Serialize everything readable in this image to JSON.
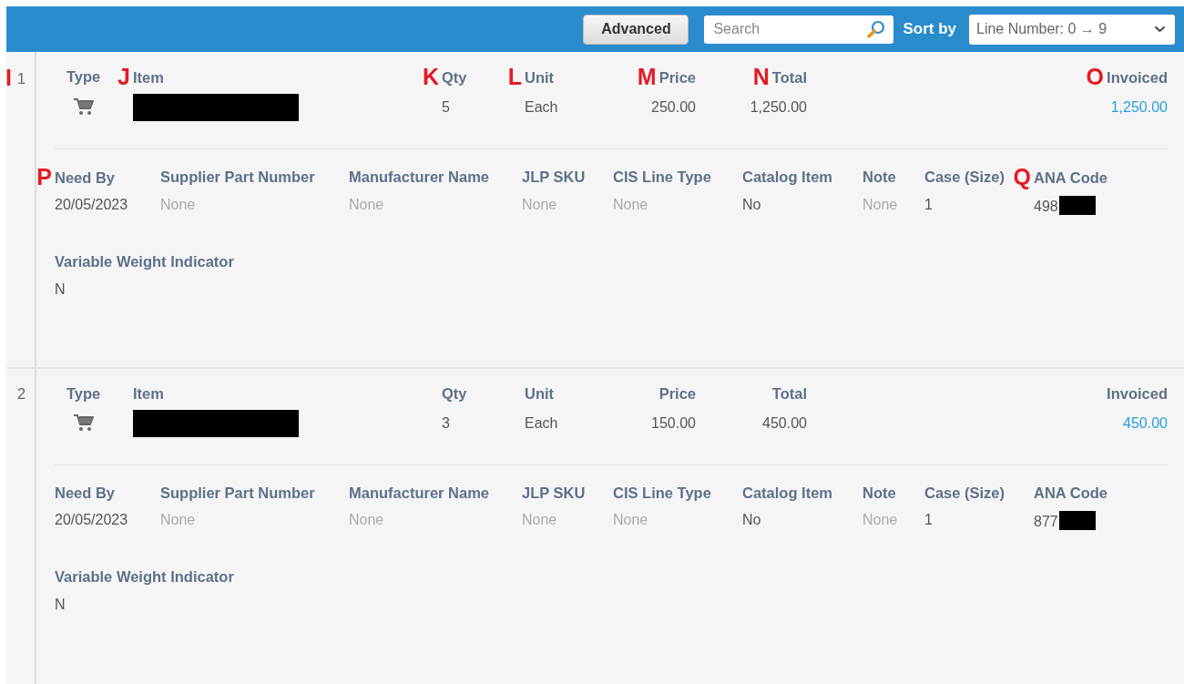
{
  "toolbar": {
    "advanced_button": "Advanced",
    "search": {
      "placeholder": "Search"
    },
    "sort_label": "Sort by",
    "sort_select": {
      "value": "Line Number: 0 → 9"
    }
  },
  "lines": [
    {
      "number": "1",
      "marker": "I",
      "summary": [
        {
          "kind": "icon",
          "label": "Type"
        },
        {
          "kind": "masked",
          "label": "Item",
          "marker": "J"
        },
        {
          "kind": "text",
          "label": "Qty",
          "value": "5",
          "marker": "K"
        },
        {
          "kind": "text",
          "label": "Unit",
          "value": "Each",
          "marker": "L"
        },
        {
          "kind": "amount",
          "label": "Price",
          "value": "250.00",
          "marker": "M"
        },
        {
          "kind": "amount",
          "label": "Total",
          "value": "1,250.00",
          "marker": "N"
        },
        {
          "kind": "link",
          "label": "Invoiced",
          "value": "1,250.00",
          "marker": "O"
        }
      ],
      "details": [
        {
          "kind": "value",
          "label": "Need By",
          "value": "20/05/2023",
          "marker": "P"
        },
        {
          "kind": "empty",
          "label": "Supplier Part Number",
          "value": "None"
        },
        {
          "kind": "empty",
          "label": "Manufacturer Name",
          "value": "None"
        },
        {
          "kind": "empty",
          "label": "JLP SKU",
          "value": "None"
        },
        {
          "kind": "empty",
          "label": "CIS Line Type",
          "value": "None"
        },
        {
          "kind": "value",
          "label": "Catalog Item",
          "value": "No"
        },
        {
          "kind": "empty",
          "label": "Note",
          "value": "None"
        },
        {
          "kind": "value",
          "label": "Case (Size)",
          "value": "1"
        },
        {
          "kind": "masked",
          "label": "ANA Code",
          "value": "498",
          "marker": "Q"
        }
      ],
      "extra": {
        "label": "Variable Weight Indicator",
        "value": "N"
      }
    },
    {
      "number": "2",
      "summary": [
        {
          "kind": "icon",
          "label": "Type"
        },
        {
          "kind": "masked",
          "label": "Item"
        },
        {
          "kind": "text",
          "label": "Qty",
          "value": "3"
        },
        {
          "kind": "text",
          "label": "Unit",
          "value": "Each"
        },
        {
          "kind": "amount",
          "label": "Price",
          "value": "150.00"
        },
        {
          "kind": "amount",
          "label": "Total",
          "value": "450.00"
        },
        {
          "kind": "link",
          "label": "Invoiced",
          "value": "450.00"
        }
      ],
      "details": [
        {
          "kind": "value",
          "label": "Need By",
          "value": "20/05/2023"
        },
        {
          "kind": "empty",
          "label": "Supplier Part Number",
          "value": "None"
        },
        {
          "kind": "empty",
          "label": "Manufacturer Name",
          "value": "None"
        },
        {
          "kind": "empty",
          "label": "JLP SKU",
          "value": "None"
        },
        {
          "kind": "empty",
          "label": "CIS Line Type",
          "value": "None"
        },
        {
          "kind": "value",
          "label": "Catalog Item",
          "value": "No"
        },
        {
          "kind": "empty",
          "label": "Note",
          "value": "None"
        },
        {
          "kind": "value",
          "label": "Case (Size)",
          "value": "1"
        },
        {
          "kind": "masked",
          "label": "ANA Code",
          "value": "877"
        }
      ],
      "extra": {
        "label": "Variable Weight Indicator",
        "value": "N"
      }
    }
  ]
}
